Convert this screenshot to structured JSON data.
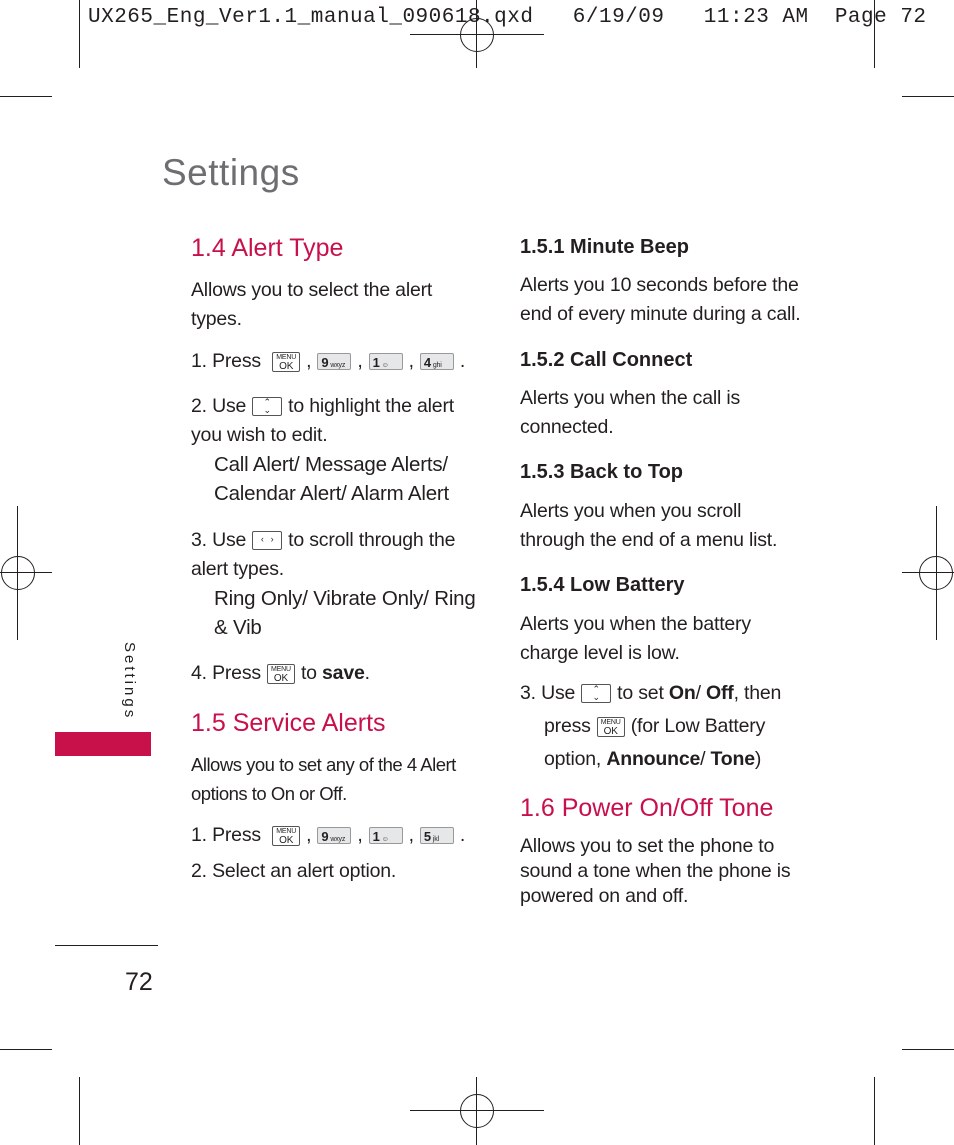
{
  "header": {
    "text": "UX265_Eng_Ver1.1_manual_090618.qxd   6/19/09   11:23 AM  Page 72"
  },
  "page": {
    "title": "Settings",
    "side_tab": "Settings",
    "number": "72",
    "accent": "#c8104a"
  },
  "alert_type": {
    "heading": "1.4 Alert Type",
    "intro": "Allows you to select the alert types.",
    "step1": "1. Press",
    "step2a": "2. Use",
    "step2b": "to highlight the alert you wish to edit.",
    "step2_options": "Call Alert/ Message Alerts/ Calendar Alert/ Alarm Alert",
    "step3a": "3. Use",
    "step3b": "to scroll through the alert types.",
    "step3_options": "Ring Only/ Vibrate Only/ Ring & Vib",
    "step4a": "4. Press",
    "step4b": "to",
    "step4_bold": "save",
    "step4c": "."
  },
  "service_alerts": {
    "heading": "1.5 Service Alerts",
    "intro": "Allows you to set any of the 4 Alert options to On or Off.",
    "step1": "1. Press",
    "step2": "2. Select an alert option."
  },
  "keys": {
    "menu_top": "MENU",
    "menu_bottom": "OK",
    "k9": "9",
    "k9_sub": "wxyz",
    "k1": "1",
    "k1_sub": "☺",
    "k4": "4",
    "k4_sub": "ghi",
    "k5": "5",
    "k5_sub": "jkl"
  },
  "minute_beep": {
    "heading": "1.5.1 Minute Beep",
    "text": "Alerts you 10 seconds before the end of every minute during a call."
  },
  "call_connect": {
    "heading": "1.5.2 Call Connect",
    "text": "Alerts you when the call is connected."
  },
  "back_to_top": {
    "heading": "1.5.3 Back to Top",
    "text": "Alerts you when you scroll through the end of a menu list."
  },
  "low_battery": {
    "heading": "1.5.4 Low Battery",
    "text": "Alerts you when the battery charge level is low."
  },
  "step3_right": {
    "a": "3. Use",
    "b": "to set",
    "on": "On",
    "slash": "/",
    "off": "Off",
    "c": ", then",
    "d": "press",
    "e": "(for Low Battery option,",
    "announce": "Announce",
    "slash2": "/",
    "tone": "Tone",
    "f": ")"
  },
  "power_tone": {
    "heading": "1.6 Power On/Off Tone",
    "text": "Allows you to set the phone to sound a tone when the phone is powered on and off."
  }
}
